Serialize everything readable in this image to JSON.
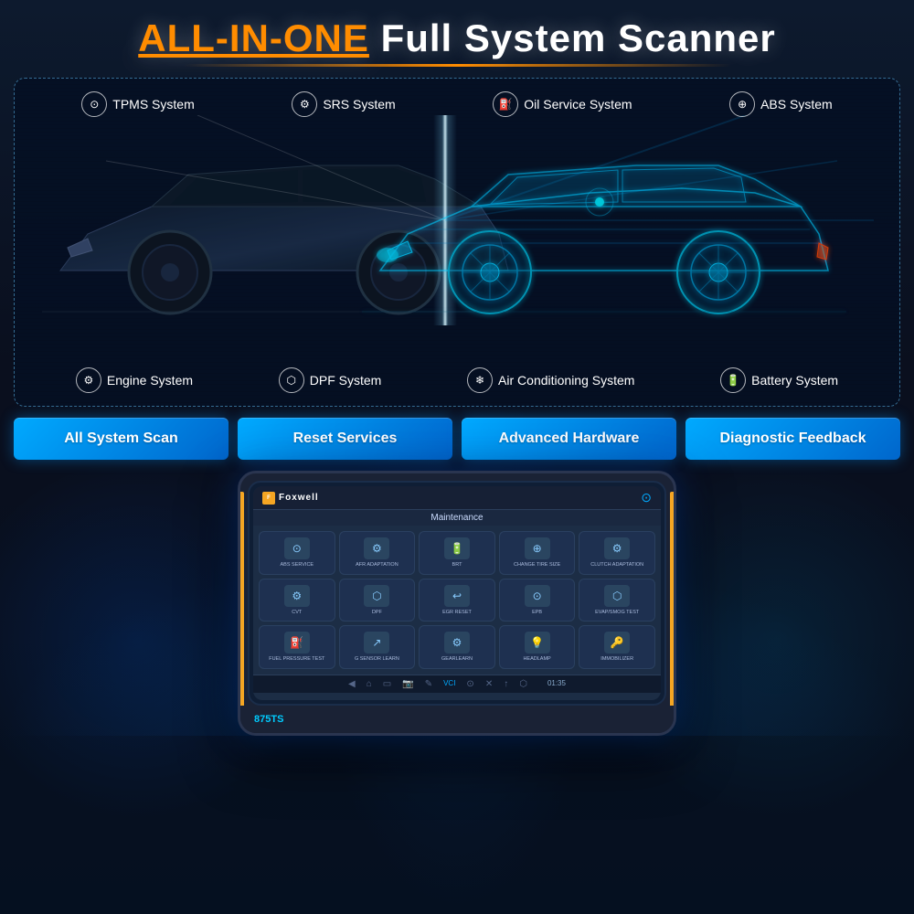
{
  "header": {
    "title_part1": "ALL-IN-ONE",
    "title_part2": " Full System Scanner",
    "underline": true
  },
  "scanner": {
    "systems_top": [
      {
        "id": "tpms",
        "label": "TPMS System",
        "icon": "⊙"
      },
      {
        "id": "srs",
        "label": "SRS System",
        "icon": "⚙"
      },
      {
        "id": "oil",
        "label": "Oil Service System",
        "icon": "⛽"
      },
      {
        "id": "abs",
        "label": "ABS System",
        "icon": "⊕"
      }
    ],
    "systems_bottom": [
      {
        "id": "engine",
        "label": "Engine System",
        "icon": "⚙"
      },
      {
        "id": "dpf",
        "label": "DPF System",
        "icon": "⬡"
      },
      {
        "id": "air",
        "label": "Air Conditioning System",
        "icon": "❄"
      },
      {
        "id": "battery",
        "label": "Battery System",
        "icon": "🔋"
      }
    ]
  },
  "feature_buttons": [
    {
      "id": "all-scan",
      "label": "All System Scan"
    },
    {
      "id": "reset",
      "label": "Reset Services"
    },
    {
      "id": "hardware",
      "label": "Advanced Hardware"
    },
    {
      "id": "feedback",
      "label": "Diagnostic Feedback"
    }
  ],
  "device": {
    "brand": "Foxwell",
    "model": "875TS",
    "screen_title": "Maintenance",
    "tpms_indicator": "⊙",
    "apps": [
      {
        "label": "ABS SERVICE",
        "icon": "⊙"
      },
      {
        "label": "AFR ADAPTATION",
        "icon": "⚙"
      },
      {
        "label": "BRT",
        "icon": "🔋"
      },
      {
        "label": "CHANGE TIRE SIZE",
        "icon": "⊕"
      },
      {
        "label": "CLUTCH ADAPTATION",
        "icon": "⚙"
      },
      {
        "label": "CVT",
        "icon": "⚙"
      },
      {
        "label": "DPF",
        "icon": "⬡"
      },
      {
        "label": "EGR RESET",
        "icon": "↩"
      },
      {
        "label": "EPB",
        "icon": "⊙"
      },
      {
        "label": "EVAP/SMOG TEST",
        "icon": "⬡"
      },
      {
        "label": "FUEL PRESSURE TEST",
        "icon": "⛽"
      },
      {
        "label": "G SENSOR LEARN",
        "icon": "↗"
      },
      {
        "label": "GEARLEARN",
        "icon": "⚙"
      },
      {
        "label": "HEADLAMP",
        "icon": "💡"
      },
      {
        "label": "IMMOBILIZER",
        "icon": "🔑"
      }
    ],
    "nav_icons": [
      "◀",
      "⌂",
      "▭",
      "📷",
      "✎",
      "VCI",
      "⊙",
      "✕",
      "↑",
      "⬡"
    ],
    "time": "01:35"
  }
}
